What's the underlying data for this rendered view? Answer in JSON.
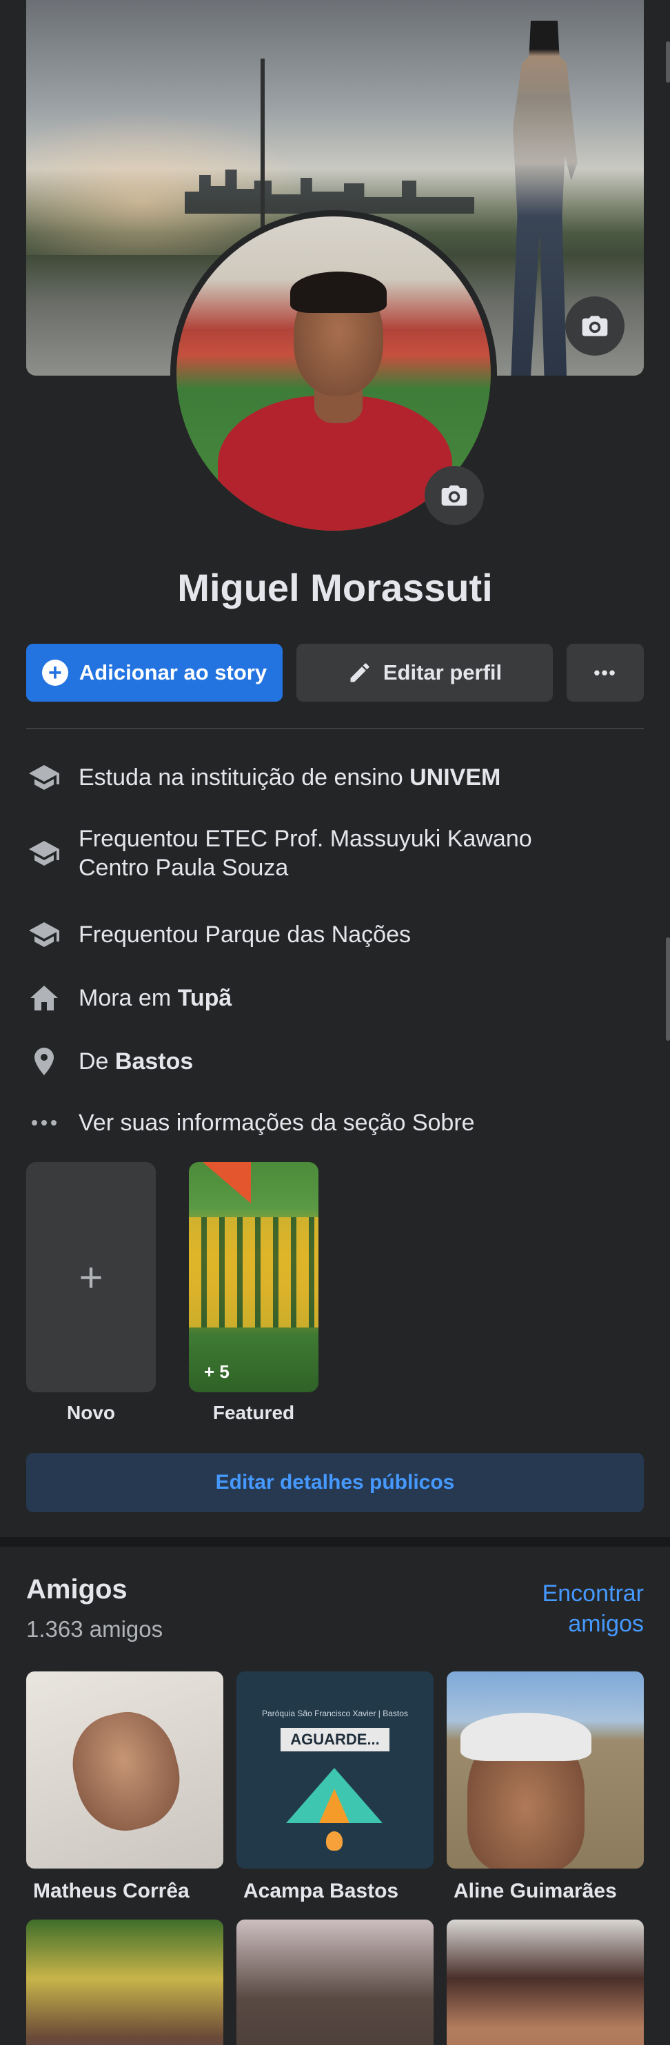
{
  "profile": {
    "name": "Miguel Morassuti"
  },
  "actions": {
    "add_story": "Adicionar ao story",
    "edit_profile": "Editar perfil",
    "more": "•••"
  },
  "info": [
    {
      "icon": "graduation-cap-icon",
      "prefix": "Estuda na instituição de ensino ",
      "bold": "UNIVEM"
    },
    {
      "icon": "graduation-cap-icon",
      "line1": "Frequentou ETEC Prof. Massuyuki Kawano",
      "line2": "Centro Paula Souza"
    },
    {
      "icon": "graduation-cap-icon",
      "text": "Frequentou Parque das Nações"
    },
    {
      "icon": "home-icon",
      "prefix": "Mora em ",
      "bold": "Tupã"
    },
    {
      "icon": "location-pin-icon",
      "prefix": "De ",
      "bold": "Bastos"
    },
    {
      "icon": "more-dots-icon",
      "text": "Ver suas informações da seção Sobre"
    }
  ],
  "highlights": {
    "new_symbol": "+",
    "new_label": "Novo",
    "featured_count": "+ 5",
    "featured_label": "Featured"
  },
  "edit_public": "Editar detalhes públicos",
  "friends": {
    "title": "Amigos",
    "count": "1.363 amigos",
    "find_line1": "Encontrar",
    "find_line2": "amigos",
    "list": [
      {
        "name": "Matheus Corrêa"
      },
      {
        "name": "Acampa Bastos",
        "banner": "AGUARDE...",
        "banner_top": "Paróquia São Francisco Xavier | Bastos"
      },
      {
        "name": "Aline Guimarães"
      },
      {
        "name": ""
      },
      {
        "name": ""
      },
      {
        "name": ""
      }
    ]
  },
  "colors": {
    "accent": "#2374e1",
    "link": "#4599ff",
    "background": "#242526"
  }
}
